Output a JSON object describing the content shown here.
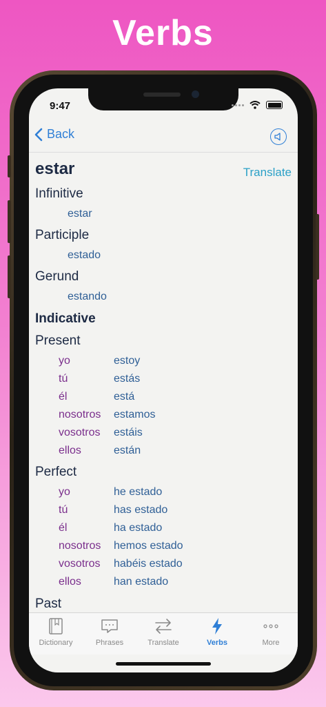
{
  "hero": {
    "title": "Verbs"
  },
  "status": {
    "time": "9:47"
  },
  "nav": {
    "back_label": "Back"
  },
  "verb": {
    "word": "estar",
    "translate_label": "Translate"
  },
  "sections": {
    "infinitive": {
      "title": "Infinitive",
      "value": "estar"
    },
    "participle": {
      "title": "Participle",
      "value": "estado"
    },
    "gerund": {
      "title": "Gerund",
      "value": "estando"
    },
    "mood": "Indicative",
    "present": {
      "title": "Present",
      "rows": [
        {
          "pronoun": "yo",
          "form": "estoy"
        },
        {
          "pronoun": "tú",
          "form": "estás"
        },
        {
          "pronoun": "él",
          "form": "está"
        },
        {
          "pronoun": "nosotros",
          "form": "estamos"
        },
        {
          "pronoun": "vosotros",
          "form": "estáis"
        },
        {
          "pronoun": "ellos",
          "form": "están"
        }
      ]
    },
    "perfect": {
      "title": "Perfect",
      "rows": [
        {
          "pronoun": "yo",
          "form": "he estado"
        },
        {
          "pronoun": "tú",
          "form": "has estado"
        },
        {
          "pronoun": "él",
          "form": "ha estado"
        },
        {
          "pronoun": "nosotros",
          "form": "hemos estado"
        },
        {
          "pronoun": "vosotros",
          "form": "habéis estado"
        },
        {
          "pronoun": "ellos",
          "form": "han estado"
        }
      ]
    },
    "past": {
      "title": "Past"
    }
  },
  "tabs": [
    {
      "label": "Dictionary",
      "icon": "book-icon"
    },
    {
      "label": "Phrases",
      "icon": "chat-bubble-icon"
    },
    {
      "label": "Translate",
      "icon": "swap-arrows-icon"
    },
    {
      "label": "Verbs",
      "icon": "lightning-icon"
    },
    {
      "label": "More",
      "icon": "more-dots-icon"
    }
  ],
  "colors": {
    "accent": "#2f7fd6",
    "pronoun": "#7a2e8c",
    "conjugation": "#2f5f96",
    "heading": "#1d2a44"
  }
}
